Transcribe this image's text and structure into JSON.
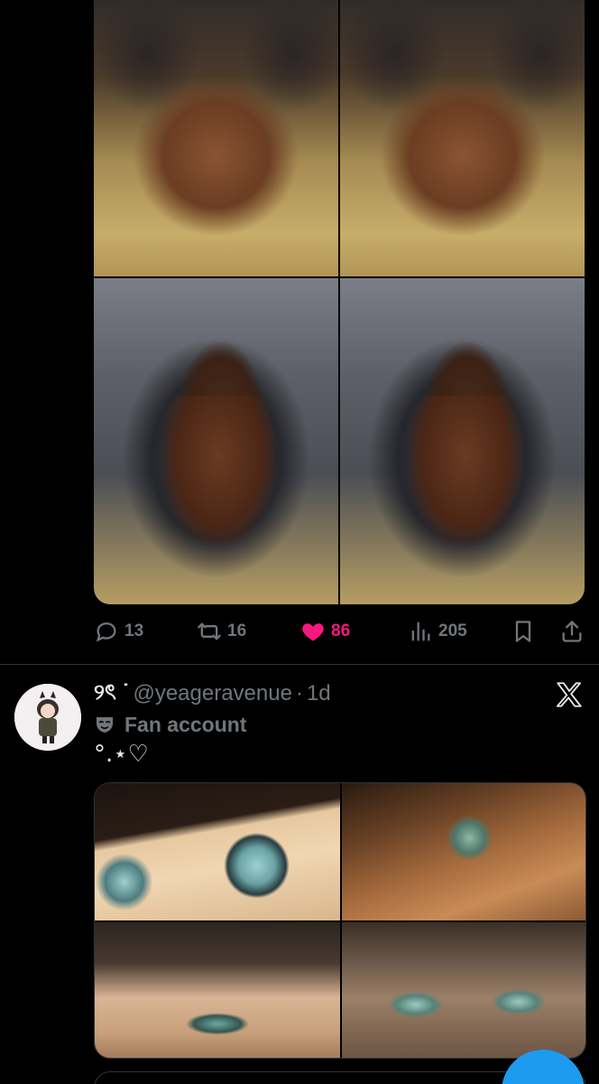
{
  "tweet1": {
    "images": [
      "photo-1",
      "photo-2",
      "photo-3",
      "photo-4"
    ],
    "actions": {
      "replies": "13",
      "reposts": "16",
      "likes": "86",
      "views": "205"
    },
    "liked": true
  },
  "tweet2": {
    "display_name": "୨ৎ ˙",
    "handle": "@yeageravenue",
    "separator": "·",
    "time": "1d",
    "label": "Fan account",
    "text": "°.⋆♡",
    "images": [
      "anime-1",
      "anime-2",
      "anime-3",
      "anime-4"
    ]
  },
  "colors": {
    "background": "#000000",
    "text": "#e7e9ea",
    "muted": "#71767b",
    "like": "#f91880",
    "accent": "#1d9bf0",
    "divider": "#2f3336"
  },
  "icons": {
    "reply": "reply-icon",
    "repost": "repost-icon",
    "like": "heart-icon",
    "views": "views-icon",
    "bookmark": "bookmark-icon",
    "share": "share-icon",
    "platform": "x-logo-icon",
    "label": "mask-icon"
  }
}
